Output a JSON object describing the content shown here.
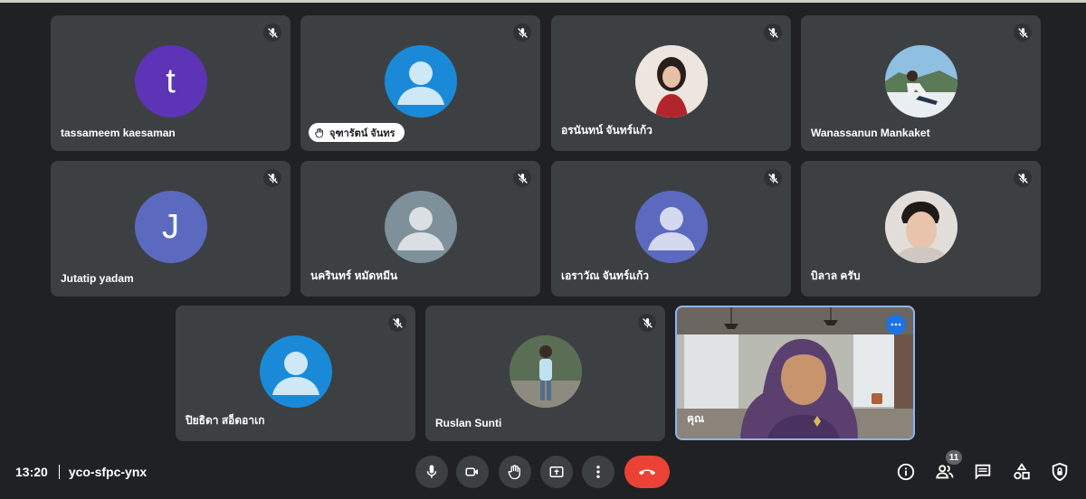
{
  "participants": [
    {
      "name": "tassameem kaesaman",
      "avatar_letter": "t",
      "avatar_color": "#5d34b5",
      "avatar_type": "letter",
      "muted": true
    },
    {
      "name": "จุฑารัตน์ จันทร",
      "avatar_color": "#1a8ad8",
      "avatar_type": "person-silhouette",
      "muted": true,
      "hand_raised": true
    },
    {
      "name": "อรนันทน์ จันทร์แก้ว",
      "avatar_type": "photo",
      "muted": true
    },
    {
      "name": "Wanassanun Mankaket",
      "avatar_type": "photo",
      "muted": true
    },
    {
      "name": "Jutatip yadam",
      "avatar_letter": "J",
      "avatar_color": "#5b6abf",
      "avatar_type": "letter",
      "muted": true
    },
    {
      "name": "นครินทร์ หมัดหมีน",
      "avatar_color": "#7e909a",
      "avatar_type": "person-silhouette",
      "muted": true
    },
    {
      "name": "เอราวัณ จันทร์แก้ว",
      "avatar_color": "#5b6abf",
      "avatar_type": "person-silhouette",
      "muted": true
    },
    {
      "name": "บิลาล ครับ",
      "avatar_type": "photo",
      "muted": true
    },
    {
      "name": "ปิยธิดา สอ็ดอาเก",
      "avatar_color": "#1a8ad8",
      "avatar_type": "person-silhouette",
      "muted": true
    },
    {
      "name": "Ruslan Sunti",
      "avatar_type": "photo",
      "muted": true
    }
  ],
  "self_view": {
    "name": "คุณ",
    "video_on": true
  },
  "meeting": {
    "time": "13:20",
    "code": "yco-sfpc-ynx"
  },
  "controls": [
    {
      "icon": "mic-icon"
    },
    {
      "icon": "camera-icon"
    },
    {
      "icon": "raise-hand-icon"
    },
    {
      "icon": "present-screen-icon"
    },
    {
      "icon": "more-options-icon"
    },
    {
      "icon": "hang-up-icon"
    }
  ],
  "right_controls": {
    "people_count": "11",
    "icons": [
      "info-icon",
      "people-icon",
      "chat-icon",
      "activities-icon",
      "host-controls-icon"
    ]
  },
  "colors": {
    "background": "#202124",
    "tile": "#3c4043",
    "hangup": "#ea4335",
    "self_border": "#8ab4f8",
    "accent": "#1a73e8"
  }
}
